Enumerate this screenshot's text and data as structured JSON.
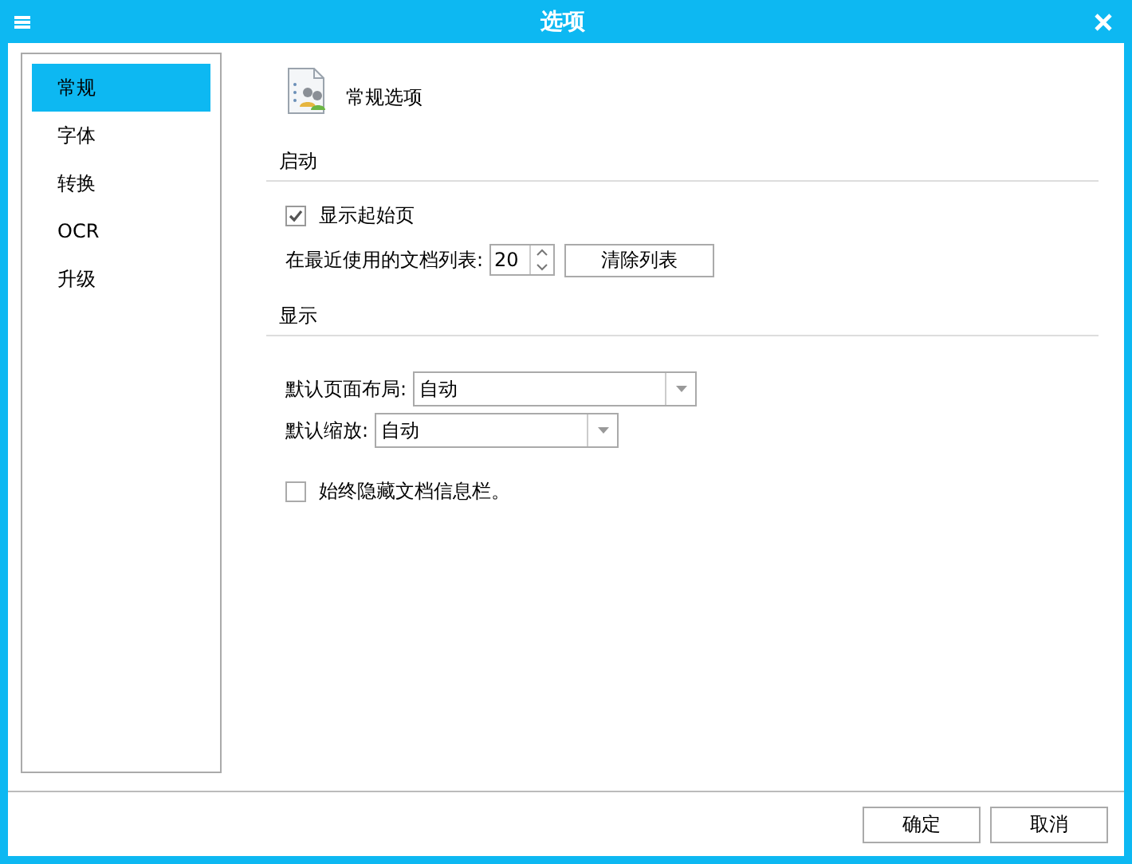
{
  "window": {
    "title": "选项"
  },
  "sidebar": {
    "items": [
      {
        "label": "常规",
        "selected": true
      },
      {
        "label": "字体",
        "selected": false
      },
      {
        "label": "转换",
        "selected": false
      },
      {
        "label": "OCR",
        "selected": false
      },
      {
        "label": "升级",
        "selected": false
      }
    ]
  },
  "page_title": "常规选项",
  "sections": [
    {
      "title": "启动",
      "rows": [
        {
          "kind": "checkbox",
          "label": "显示起始页",
          "checked": true
        },
        {
          "kind": "spinner",
          "label": "在最近使用的文档列表:",
          "value": "20",
          "button": "清除列表"
        }
      ]
    },
    {
      "title": "显示",
      "rows": [
        {
          "kind": "dropdown",
          "label": "默认页面布局:",
          "value": "自动"
        },
        {
          "kind": "dropdown",
          "label": "默认缩放:",
          "value": "自动"
        },
        {
          "kind": "checkbox",
          "label": "始终隐藏文档信息栏。",
          "checked": false
        }
      ]
    }
  ],
  "buttons": [
    "确定",
    "取消"
  ]
}
